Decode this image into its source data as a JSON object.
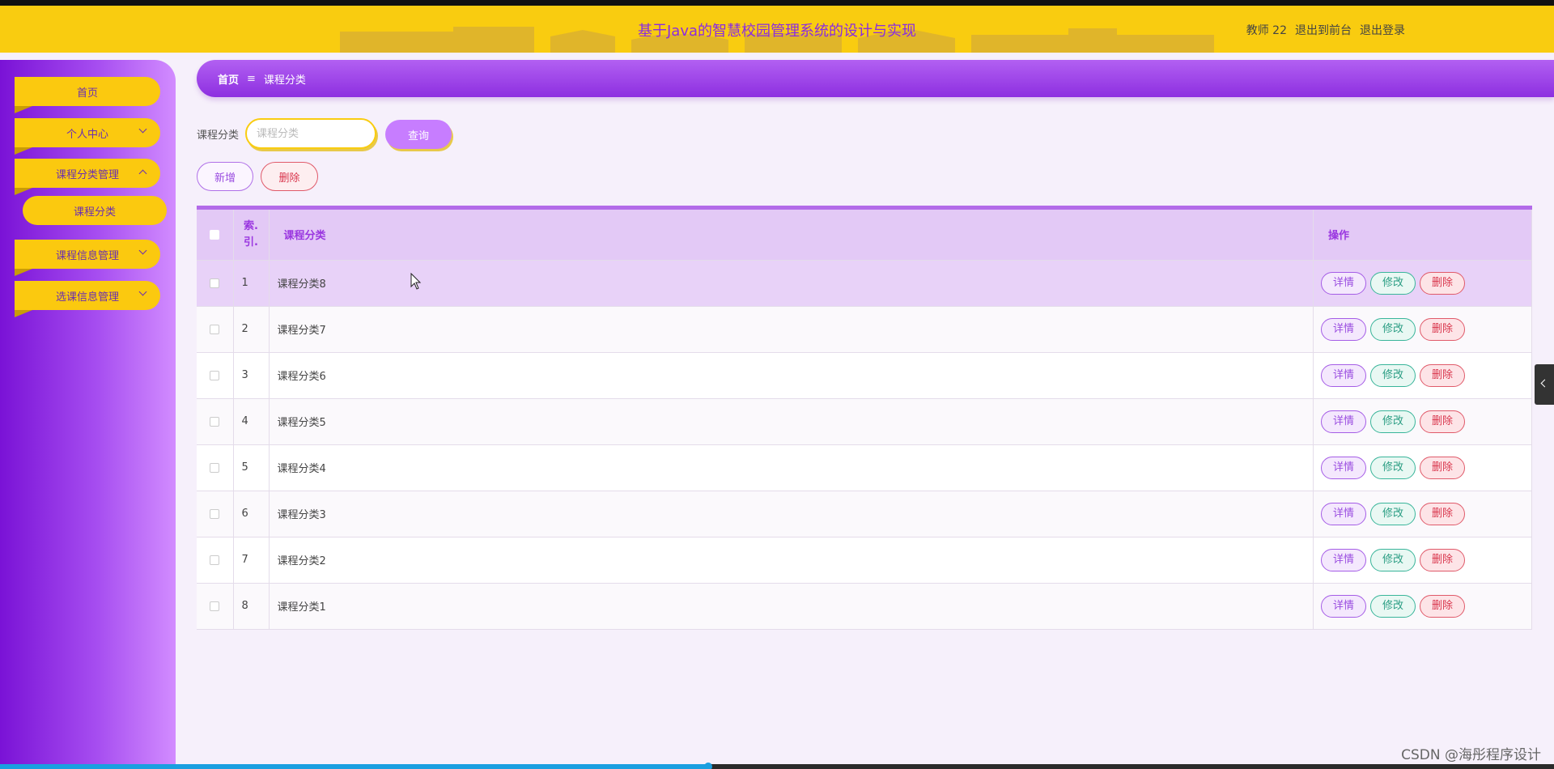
{
  "header": {
    "title": "基于Java的智慧校园管理系统的设计与实现",
    "user_label": "教师 22",
    "front_label": "退出到前台",
    "logout_label": "退出登录"
  },
  "sidebar": {
    "items": [
      {
        "label": "首页"
      },
      {
        "label": "个人中心"
      },
      {
        "label": "课程分类管理"
      },
      {
        "label": "课程分类"
      },
      {
        "label": "课程信息管理"
      },
      {
        "label": "选课信息管理"
      }
    ]
  },
  "breadcrumb": {
    "home": "首页",
    "separator": "≡",
    "current": "课程分类"
  },
  "search": {
    "label": "课程分类",
    "placeholder": "课程分类",
    "button": "查询"
  },
  "actions": {
    "add": "新增",
    "delete": "删除"
  },
  "table": {
    "headers": {
      "index_line1": "索",
      "index_line2": "引",
      "name": "课程分类",
      "ops": "操作"
    },
    "rows": [
      {
        "index": "1",
        "name": "课程分类8"
      },
      {
        "index": "2",
        "name": "课程分类7"
      },
      {
        "index": "3",
        "name": "课程分类6"
      },
      {
        "index": "4",
        "name": "课程分类5"
      },
      {
        "index": "5",
        "name": "课程分类4"
      },
      {
        "index": "6",
        "name": "课程分类3"
      },
      {
        "index": "7",
        "name": "课程分类2"
      },
      {
        "index": "8",
        "name": "课程分类1"
      }
    ],
    "op_labels": {
      "detail": "详情",
      "edit": "修改",
      "remove": "删除"
    }
  },
  "watermark": "CSDN @海彤程序设计",
  "colors": {
    "header_yellow": "#f9cc10",
    "sidebar_purple": "#7a12d6",
    "accent_purple": "#9a36e0",
    "danger": "#d9364d",
    "success": "#2a9d83"
  }
}
